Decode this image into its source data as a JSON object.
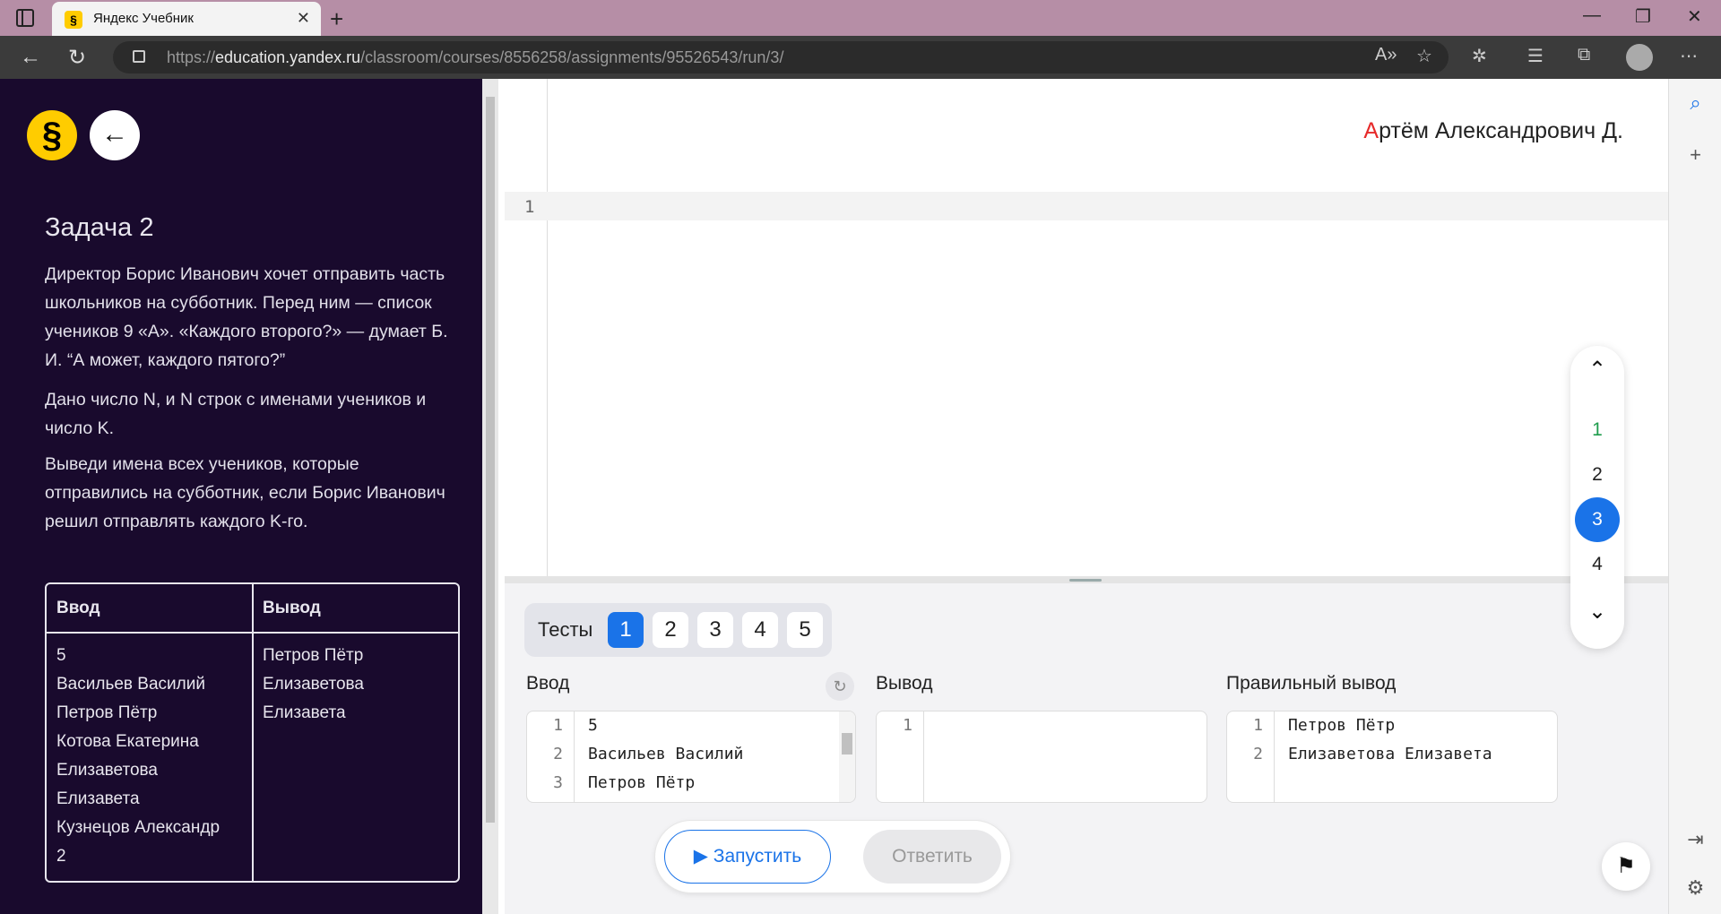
{
  "browser": {
    "tab_title": "Яндекс Учебник",
    "tab_close": "✕",
    "new_tab": "+",
    "url_host": "education.yandex.ru",
    "url_prefix": "https://",
    "url_path": "/classroom/courses/8556258/assignments/95526543/run/3/"
  },
  "sidebar_left": {
    "logo_glyph": "§",
    "back_glyph": "←",
    "task_title": "Задача 2",
    "paragraphs": [
      "Директор Борис Иванович хочет отправить часть школьников на субботник. Перед ним — список учеников 9 «А». «Каждого второго?» — думает Б. И. “А может, каждого пятого?”",
      "Дано число N, и N строк с именами учеников и число K.",
      "Выведи имена всех учеников, которые отправились на субботник, если Борис Иванович решил отправлять каждого K-го."
    ],
    "table": {
      "headers": [
        "Ввод",
        "Вывод"
      ],
      "input": "5\nВасильев Василий\nПетров Пётр\nКотова Екатерина\nЕлизаветова\nЕлизавета\nКузнецов Александр\n2",
      "output": "Петров Пётр\nЕлизаветова\nЕлизавета"
    }
  },
  "editor": {
    "user_initial": "А",
    "user_rest": "ртём Александрович Д.",
    "line_number": "1"
  },
  "tests": {
    "label": "Тесты",
    "buttons": [
      "1",
      "2",
      "3",
      "4",
      "5"
    ],
    "active": "1"
  },
  "io": {
    "input_label": "Ввод",
    "output_label": "Вывод",
    "expected_label": "Правильный вывод",
    "input_line_numbers": "1\n2\n3",
    "input_lines": "5\nВасильев Василий\nПетров Пётр",
    "output_line_numbers": "1",
    "expected_line_numbers": "1\n2",
    "expected_lines": "Петров Пётр\nЕлизаветова Елизавета"
  },
  "actions": {
    "run_label": "Запустить",
    "answer_label": "Ответить"
  },
  "pager": {
    "up": "⌃",
    "down": "⌄",
    "items": [
      "1",
      "2",
      "3",
      "4"
    ],
    "active": "3",
    "solved": "1"
  },
  "colors": {
    "left_bg": "#190a2d",
    "accent_blue": "#1a73e8",
    "logo_yellow": "#ffcc00",
    "solved_green": "#1f9d4d",
    "user_initial_red": "#e62a2a"
  }
}
